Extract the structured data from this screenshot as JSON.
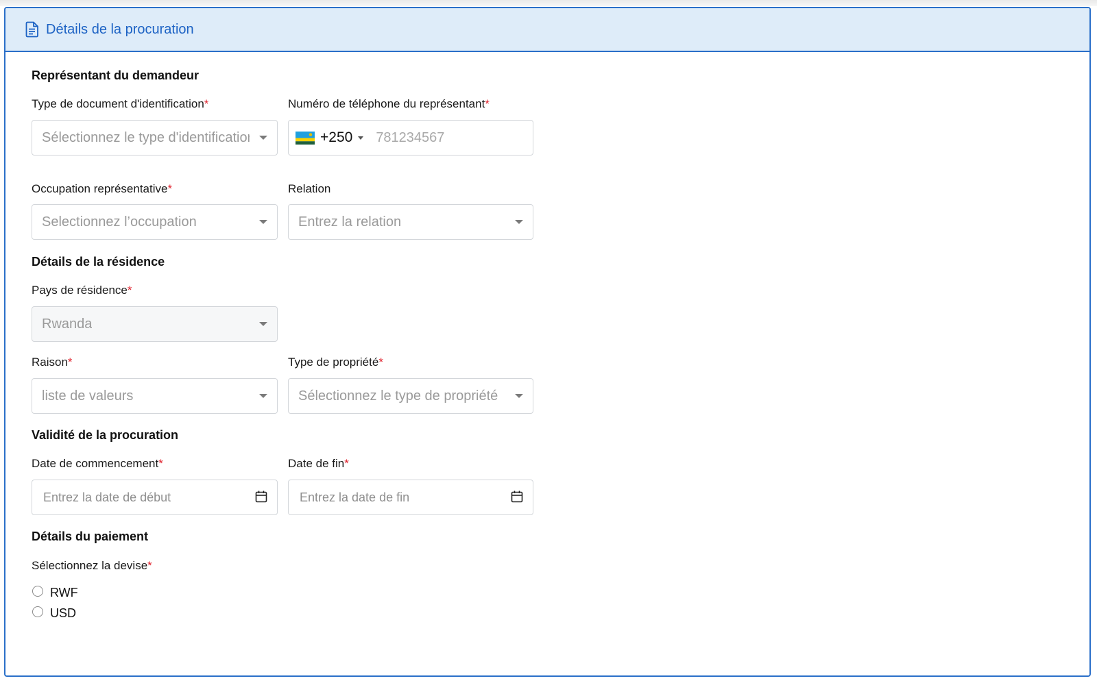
{
  "header": {
    "title": "Détails de la procuration",
    "icon": "document-icon"
  },
  "sections": {
    "representative": "Représentant du demandeur",
    "residence": "Détails de la résidence",
    "validity": "Validité de la procuration",
    "payment": "Détails du paiement"
  },
  "fields": {
    "id_doc_type": {
      "label": "Type de document d'identification",
      "placeholder": "Sélectionnez le type d'identificatior"
    },
    "phone": {
      "label": "Numéro de téléphone du représentant",
      "dial_code": "+250",
      "placeholder": "781234567",
      "country_flag": "rwanda-flag-icon"
    },
    "occupation": {
      "label": "Occupation représentative",
      "placeholder": "Selectionnez l’occupation"
    },
    "relation": {
      "label": "Relation",
      "placeholder": "Entrez la relation"
    },
    "country": {
      "label": "Pays de résidence",
      "value": "Rwanda"
    },
    "reason": {
      "label": "Raison",
      "placeholder": "liste de valeurs"
    },
    "property_type": {
      "label": "Type de propriété",
      "placeholder": "Sélectionnez le type de propriété"
    },
    "start_date": {
      "label": "Date de commencement",
      "placeholder": "Entrez la date de début"
    },
    "end_date": {
      "label": "Date de fin",
      "placeholder": "Entrez la date de fin"
    },
    "currency": {
      "label": "Sélectionnez la devise",
      "options": [
        "RWF",
        "USD"
      ]
    }
  },
  "required_marker": "*",
  "colors": {
    "accent": "#2a6fc9",
    "header_bg": "#deecf9",
    "required": "#e0242f"
  }
}
